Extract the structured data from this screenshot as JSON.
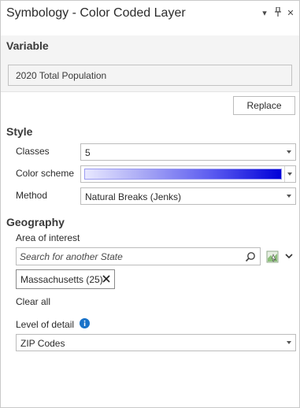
{
  "header": {
    "title": "Symbology - Color Coded Layer",
    "menu_glyph": "▾",
    "pin_glyph": "ᵽ",
    "close_glyph": "✕"
  },
  "variable": {
    "section_title": "Variable",
    "value": "2020 Total Population",
    "replace_label": "Replace"
  },
  "style": {
    "section_title": "Style",
    "classes_label": "Classes",
    "classes_value": "5",
    "color_scheme_label": "Color scheme",
    "color_scheme_colors": [
      "#e8e8ff",
      "#0000d8"
    ],
    "method_label": "Method",
    "method_value": "Natural Breaks (Jenks)"
  },
  "geography": {
    "section_title": "Geography",
    "area_label": "Area of interest",
    "search_placeholder": "Search for another State",
    "chips": [
      {
        "label": "Massachusetts (25)"
      }
    ],
    "clear_all_label": "Clear all",
    "detail_label": "Level of detail",
    "detail_value": "ZIP Codes"
  },
  "colors": {
    "accent": "#0078d4",
    "section_bg": "#f4f4f4",
    "info_icon": "#1a73c9"
  }
}
